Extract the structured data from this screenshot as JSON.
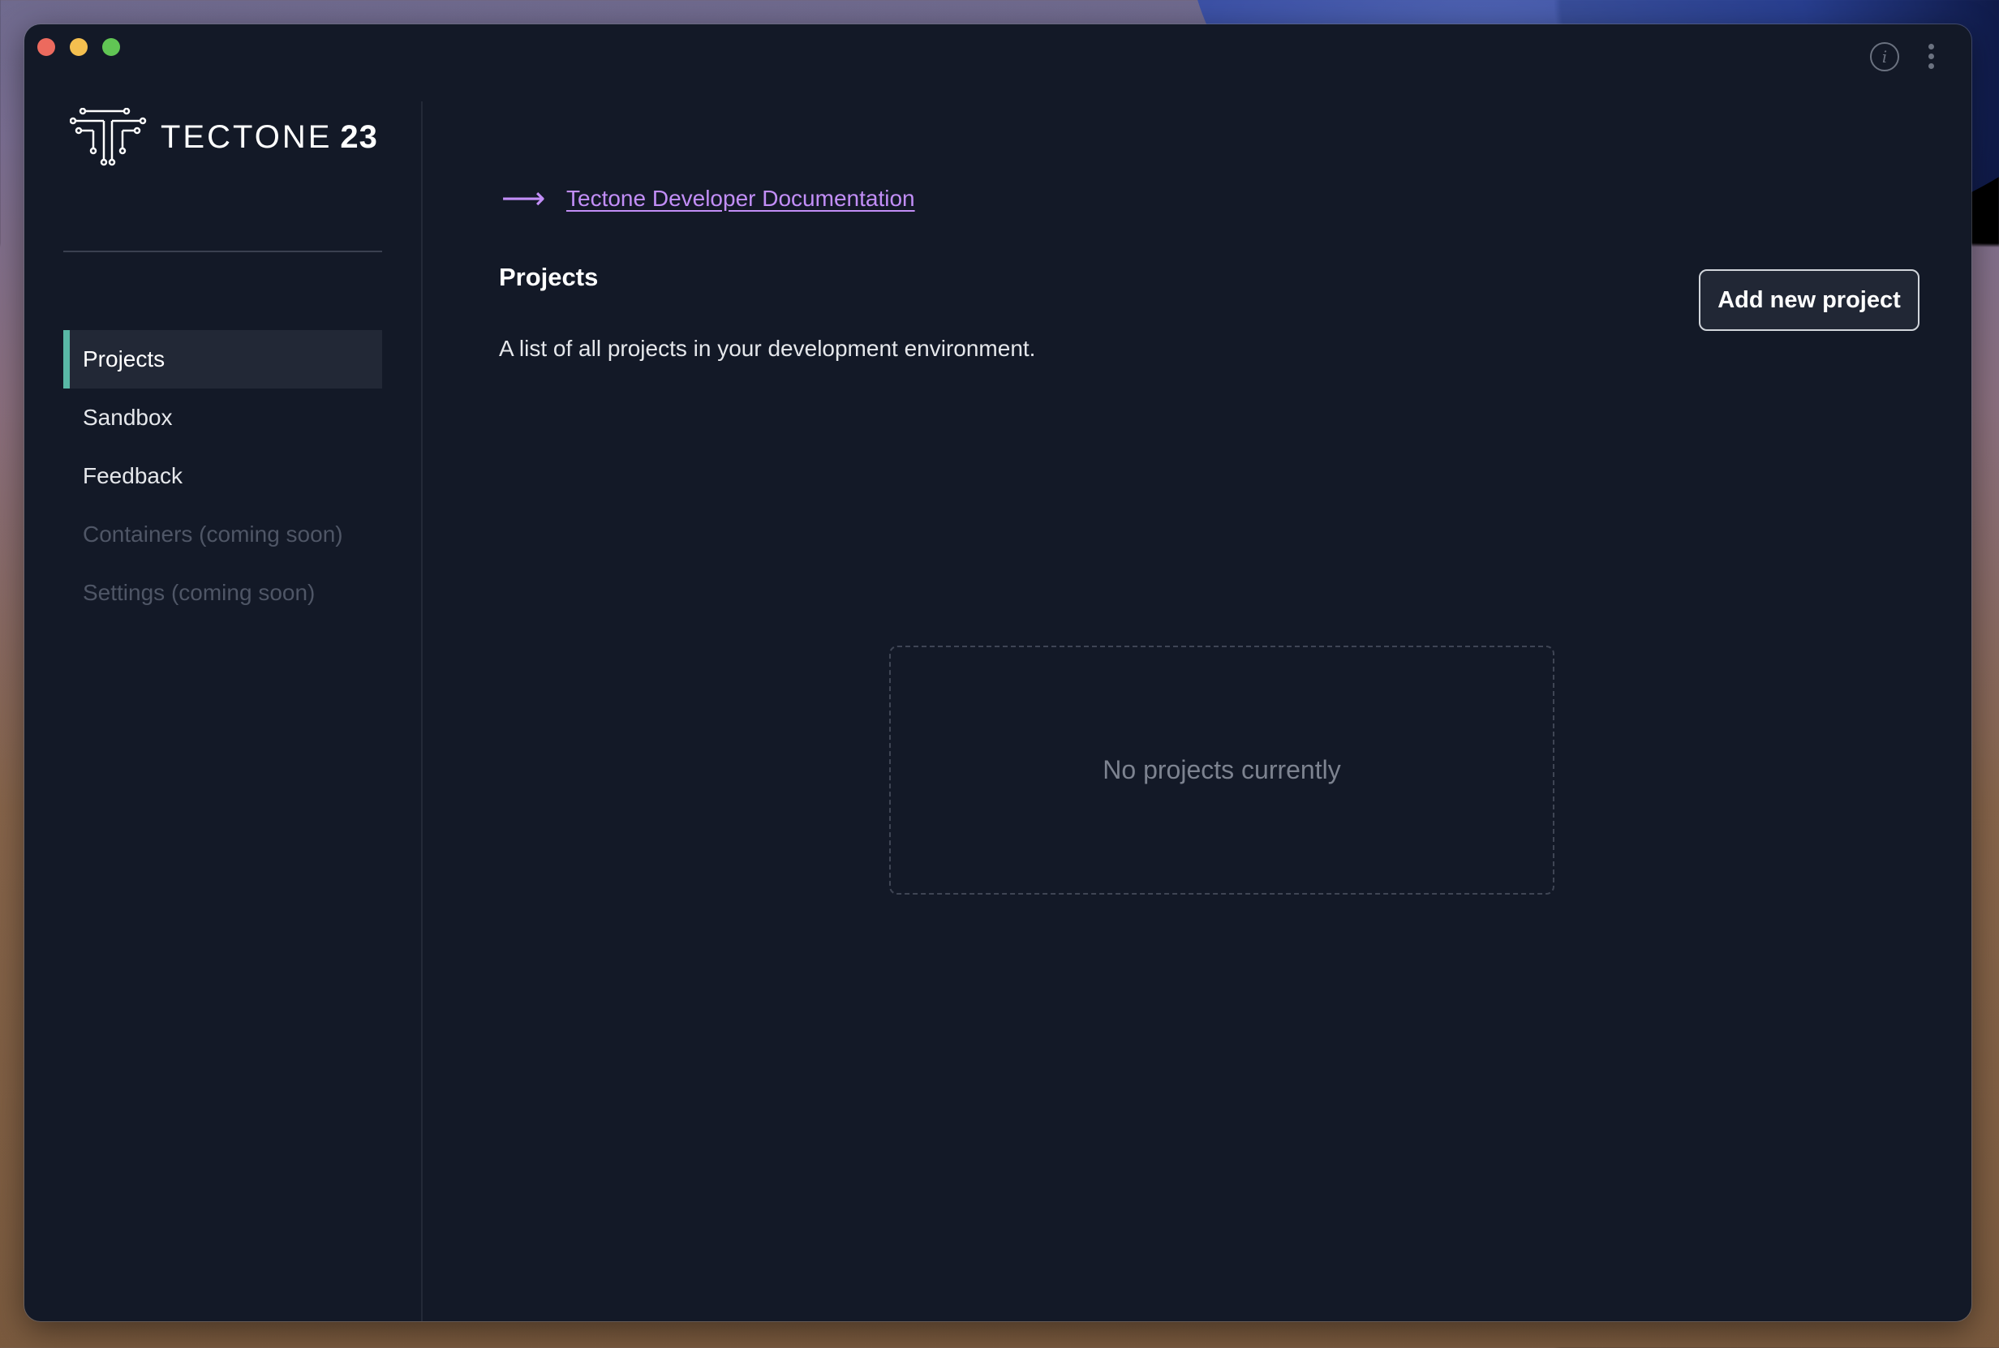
{
  "window": {
    "traffic_lights": [
      {
        "name": "close",
        "color": "#ec6a5e"
      },
      {
        "name": "minimize",
        "color": "#f4bf4f"
      },
      {
        "name": "maximize",
        "color": "#61c554"
      }
    ],
    "top_icons": [
      {
        "name": "info-icon",
        "glyph": "i"
      },
      {
        "name": "more-vertical-icon",
        "glyph": "⋮"
      }
    ]
  },
  "brand": {
    "name": "TECTONE",
    "number": "23"
  },
  "sidebar": {
    "items": [
      {
        "label": "Projects",
        "state": "active"
      },
      {
        "label": "Sandbox",
        "state": "enabled"
      },
      {
        "label": "Feedback",
        "state": "enabled"
      },
      {
        "label": "Containers (coming soon)",
        "state": "disabled"
      },
      {
        "label": "Settings (coming soon)",
        "state": "disabled"
      }
    ],
    "accent_color": "#59b8a6"
  },
  "main": {
    "doc_link": {
      "arrow": "⟶",
      "label": "Tectone Developer Documentation",
      "color": "#c28ef7"
    },
    "title": "Projects",
    "subtitle": "A list of all projects in your development environment.",
    "add_button_label": "Add new project",
    "empty_state": "No projects currently"
  }
}
